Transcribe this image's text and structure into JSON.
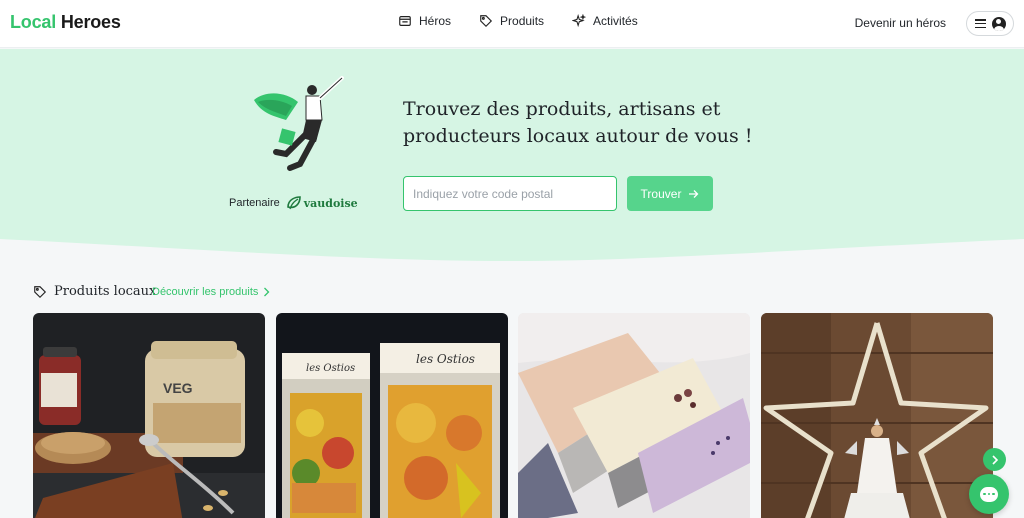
{
  "header": {
    "logo_part1": "Local",
    "logo_part2": "Heroes",
    "nav": [
      {
        "label": "Héros",
        "icon": "store-icon"
      },
      {
        "label": "Produits",
        "icon": "tag-icon"
      },
      {
        "label": "Activités",
        "icon": "sparkles-icon"
      }
    ],
    "become_hero": "Devenir un héros"
  },
  "hero": {
    "headline": "Trouvez des produits, artisans et producteurs locaux autour de vous !",
    "partner_label": "Partenaire",
    "partner_name": "vaudoise",
    "search_placeholder": "Indiquez votre code postal",
    "search_value": "",
    "find_button": "Trouver",
    "background_color": "#d6f5e4"
  },
  "section": {
    "title": "Produits locaux",
    "discover_link": "Découvrir les produits"
  },
  "products": [
    {
      "name": "product-card-spreads"
    },
    {
      "name": "product-card-ostios"
    },
    {
      "name": "product-card-soaps"
    },
    {
      "name": "product-card-star-decoration"
    }
  ],
  "colors": {
    "accent": "#35c46d",
    "accent_button": "#56d48c"
  }
}
